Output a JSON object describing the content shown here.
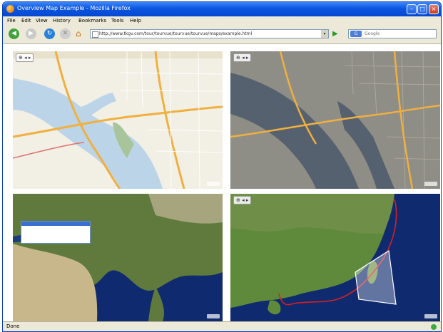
{
  "window": {
    "title": "Overview Map Example - Mozilla Firefox"
  },
  "menu": {
    "items": [
      "File",
      "Edit",
      "View",
      "History",
      "Bookmarks",
      "Tools",
      "Help"
    ]
  },
  "toolbar": {
    "url": "http://www.tkgv.com/tour/tourvue/tourvue/tourvue/maps/example.html",
    "search_placeholder": "Google"
  },
  "status": {
    "text": "Done"
  },
  "icons": [
    "back-icon",
    "forward-icon",
    "reload-icon",
    "stop-icon",
    "home-icon",
    "go-icon",
    "search-engine-icon",
    "page-icon",
    "status-icon"
  ],
  "colors": {
    "titlebar": "#0a55e0",
    "route": "#d62020",
    "water": "#bcd4e8",
    "satellite_sea": "#0f2a6e"
  }
}
